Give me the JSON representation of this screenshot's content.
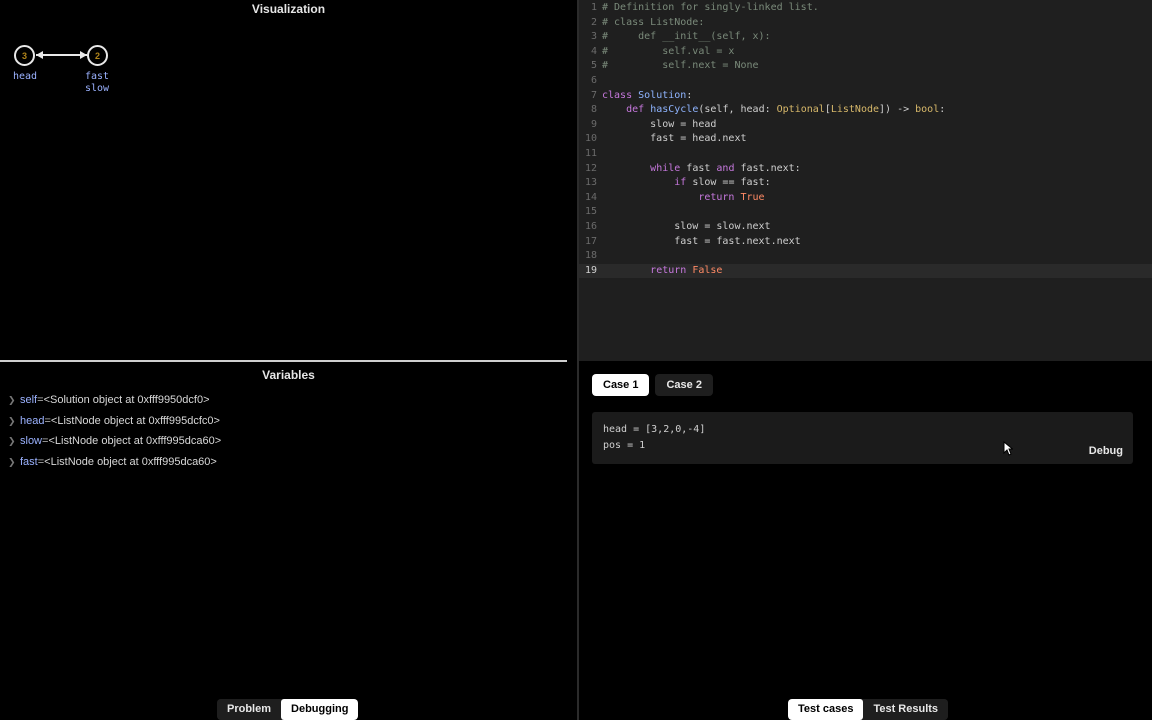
{
  "visualization": {
    "title": "Visualization",
    "nodes": [
      {
        "value": "3"
      },
      {
        "value": "2"
      }
    ],
    "pointers": {
      "head": "head",
      "fast": "fast",
      "slow": "slow"
    }
  },
  "editor": {
    "lines": [
      {
        "n": "1",
        "text": "# Definition for singly-linked list."
      },
      {
        "n": "2",
        "text": "# class ListNode:"
      },
      {
        "n": "3",
        "text": "#     def __init__(self, x):"
      },
      {
        "n": "4",
        "text": "#         self.val = x"
      },
      {
        "n": "5",
        "text": "#         self.next = None"
      },
      {
        "n": "6",
        "text": ""
      },
      {
        "n": "7",
        "text": "class Solution:"
      },
      {
        "n": "8",
        "text": "    def hasCycle(self, head: Optional[ListNode]) -> bool:"
      },
      {
        "n": "9",
        "text": "        slow = head"
      },
      {
        "n": "10",
        "text": "        fast = head.next"
      },
      {
        "n": "11",
        "text": ""
      },
      {
        "n": "12",
        "text": "        while fast and fast.next:"
      },
      {
        "n": "13",
        "text": "            if slow == fast:"
      },
      {
        "n": "14",
        "text": "                return True"
      },
      {
        "n": "15",
        "text": ""
      },
      {
        "n": "16",
        "text": "            slow = slow.next"
      },
      {
        "n": "17",
        "text": "            fast = fast.next.next"
      },
      {
        "n": "18",
        "text": ""
      },
      {
        "n": "19",
        "text": "        return False"
      }
    ],
    "active_line": "19"
  },
  "variables": {
    "title": "Variables",
    "items": [
      {
        "name": "self",
        "eq": " = ",
        "value": "<Solution object at 0xfff9950dcf0>"
      },
      {
        "name": "head",
        "eq": " = ",
        "value": "<ListNode object at 0xfff995dcfc0>"
      },
      {
        "name": "slow",
        "eq": " = ",
        "value": "<ListNode object at 0xfff995dca60>"
      },
      {
        "name": "fast",
        "eq": " = ",
        "value": "<ListNode object at 0xfff995dca60>"
      }
    ]
  },
  "left_tabs": {
    "problem": "Problem",
    "debugging": "Debugging"
  },
  "right_tabs": {
    "test_cases": "Test cases",
    "test_results": "Test Results"
  },
  "tests": {
    "cases": [
      {
        "label": "Case 1"
      },
      {
        "label": "Case 2"
      }
    ],
    "active_case": "Case 1",
    "input_lines": [
      "head = [3,2,0,-4]",
      "pos = 1"
    ],
    "debug_label": "Debug"
  },
  "colors": {
    "background": "#000000",
    "editor_background": "#1f1f1f",
    "pointer_label": "#9bb2ff",
    "active_tab_bg": "#ffffff"
  }
}
